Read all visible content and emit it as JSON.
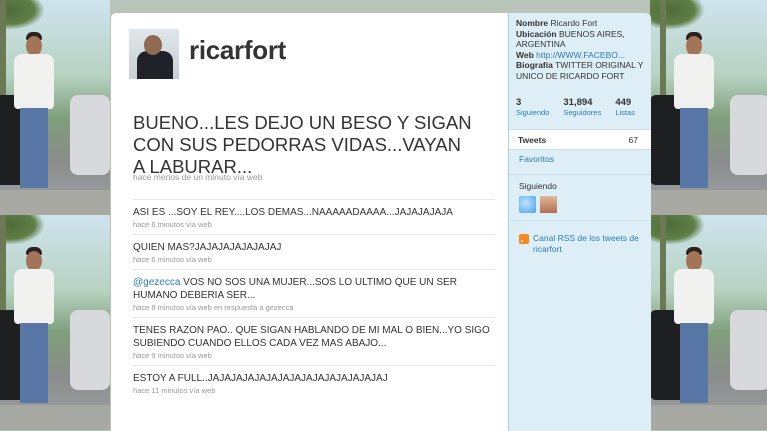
{
  "profile": {
    "screen_name": "ricarfort"
  },
  "big_tweet": {
    "text": "BUENO...LES DEJO UN BESO Y SIGAN CON SUS PEDORRAS VIDAS...VAYAN A LABURAR...",
    "meta": "hace menos de un minuto vía web"
  },
  "tweets": [
    {
      "text": "ASI ES ...SOY EL REY....LOS DEMAS...NAAAAADAAAA...JAJAJAJAJA",
      "meta": "hace 6 minutos vía web"
    },
    {
      "text": "QUIEN MAS?JAJAJAJAJAJAJAJ",
      "meta": "hace 6 minutos vía web"
    },
    {
      "mention": "@gezecca",
      "text": " VOS NO SOS UNA MUJER...SOS LO ULTIMO QUE UN SER HUMANO DEBERIA SER...",
      "meta": "hace 8 minutos vía web en respuesta a gezecca"
    },
    {
      "text": "TENES RAZON PAO.. QUE SIGAN HABLANDO DE MI MAL O BIEN...YO SIGO SUBIENDO CUANDO ELLOS CADA VEZ MAS ABAJO...",
      "meta": "hace 9 minutos vía web"
    },
    {
      "text": "ESTOY A FULL..JAJAJAJAJAJAJAJAJAJAJAJAJAJAJAJ",
      "meta": "hace 11 minutos vía web"
    }
  ],
  "sidebar": {
    "nombre_label": "Nombre",
    "nombre_value": "Ricardo Fort",
    "ubicacion_label": "Ubicación",
    "ubicacion_value": "BUENOS AIRES, ARGENTINA",
    "web_label": "Web",
    "web_value": "http://WWW.FACEBO...",
    "biografia_label": "Biografía",
    "biografia_value": "TWITTER ORIGINAL Y UNICO DE RICARDO FORT",
    "stats": [
      {
        "num": "3",
        "label": "Siguiendo"
      },
      {
        "num": "31,894",
        "label": "Seguidores"
      },
      {
        "num": "449",
        "label": "Listas"
      }
    ],
    "tweets_label": "Tweets",
    "tweets_count": "67",
    "favoritos_label": "Favoritos",
    "siguiendo_label": "Siguiendo",
    "rss_label": "Canal RSS de los tweets de ricarfort"
  },
  "colors": {
    "link": "#2b7bb9",
    "sidebar_bg": "#ddeef6",
    "sidebar_border": "#a9d0e0"
  }
}
